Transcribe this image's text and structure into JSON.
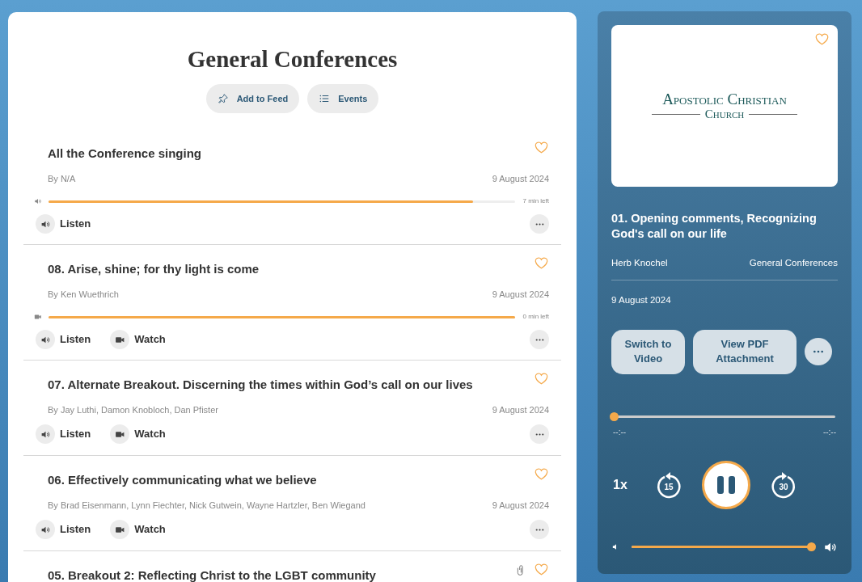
{
  "page": {
    "title": "General Conferences",
    "actions": [
      {
        "kind": "pin",
        "label": "Add to Feed"
      },
      {
        "kind": "list",
        "label": "Events"
      }
    ]
  },
  "items": [
    {
      "title": "All the Conference singing",
      "byline": "By N/A",
      "date": "9 August 2024",
      "favorite": false,
      "progress": {
        "kind": "audio",
        "level": 0.91,
        "remaining": "7 min left"
      },
      "actions": [
        {
          "kind": "listen",
          "label": "Listen"
        }
      ]
    },
    {
      "title": "08. Arise, shine; for thy light is come",
      "byline": "By Ken Wuethrich",
      "date": "9 August 2024",
      "favorite": false,
      "progress": {
        "kind": "video",
        "level": 1.0,
        "remaining": "0 min left"
      },
      "actions": [
        {
          "kind": "listen",
          "label": "Listen"
        },
        {
          "kind": "watch",
          "label": "Watch"
        }
      ]
    },
    {
      "title": "07. Alternate Breakout. Discerning the times within God’s call on our lives",
      "byline": "By Jay Luthi, Damon Knobloch, Dan Pfister",
      "date": "9 August 2024",
      "favorite": false,
      "actions": [
        {
          "kind": "listen",
          "label": "Listen"
        },
        {
          "kind": "watch",
          "label": "Watch"
        }
      ]
    },
    {
      "title": "06. Effectively communicating what we believe",
      "byline": "By Brad Eisenmann, Lynn Fiechter, Nick Gutwein, Wayne Hartzler, Ben Wiegand",
      "date": "9 August 2024",
      "favorite": false,
      "actions": [
        {
          "kind": "listen",
          "label": "Listen"
        },
        {
          "kind": "watch",
          "label": "Watch"
        }
      ]
    },
    {
      "title": "05. Breakout 2: Reflecting Christ to the LGBT community",
      "favorite": false,
      "attachment": true
    }
  ],
  "player": {
    "favorite": false,
    "logo": {
      "line1": "Apostolic Christian",
      "line2": "Church"
    },
    "title": "01. Opening comments, Recognizing God's call on our life",
    "speaker": "Herb Knochel",
    "series": "General Conferences",
    "date": "9 August 2024",
    "buttons": [
      "Switch to Video",
      "View PDF Attachment"
    ],
    "seek": {
      "level": 0,
      "elapsed": "--:--",
      "remaining": "--:--"
    },
    "speed": "1x",
    "rewind": "15",
    "forward": "30",
    "playing": true,
    "volume": {
      "level": 1.0
    }
  }
}
